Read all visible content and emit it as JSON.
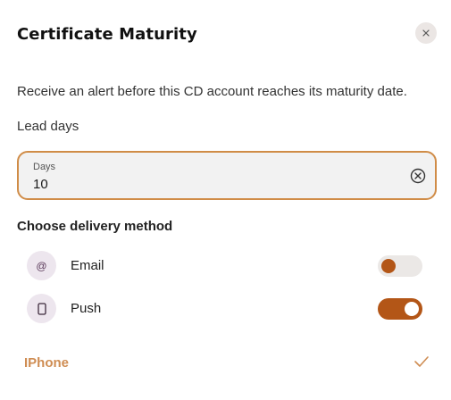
{
  "dialog": {
    "title": "Certificate Maturity",
    "description": "Receive an alert before this CD account reaches its maturity date.",
    "close_icon": "close-icon"
  },
  "lead": {
    "label": "Lead days",
    "field_label": "Days",
    "value": "10",
    "clear_icon": "clear-circle-icon"
  },
  "delivery": {
    "title": "Choose delivery method",
    "options": [
      {
        "label": "Email",
        "icon": "at-sign-icon",
        "icon_glyph": "@",
        "enabled": false
      },
      {
        "label": "Push",
        "icon": "phone-icon",
        "enabled": true
      }
    ]
  },
  "device": {
    "name": "IPhone",
    "selected": true,
    "check_icon": "check-icon"
  },
  "colors": {
    "accent": "#b35617",
    "field_border": "#d08c47",
    "device_text": "#cf8d53",
    "toggle_off_track": "#ebe8e6",
    "icon_bg": "#ede6ee"
  }
}
